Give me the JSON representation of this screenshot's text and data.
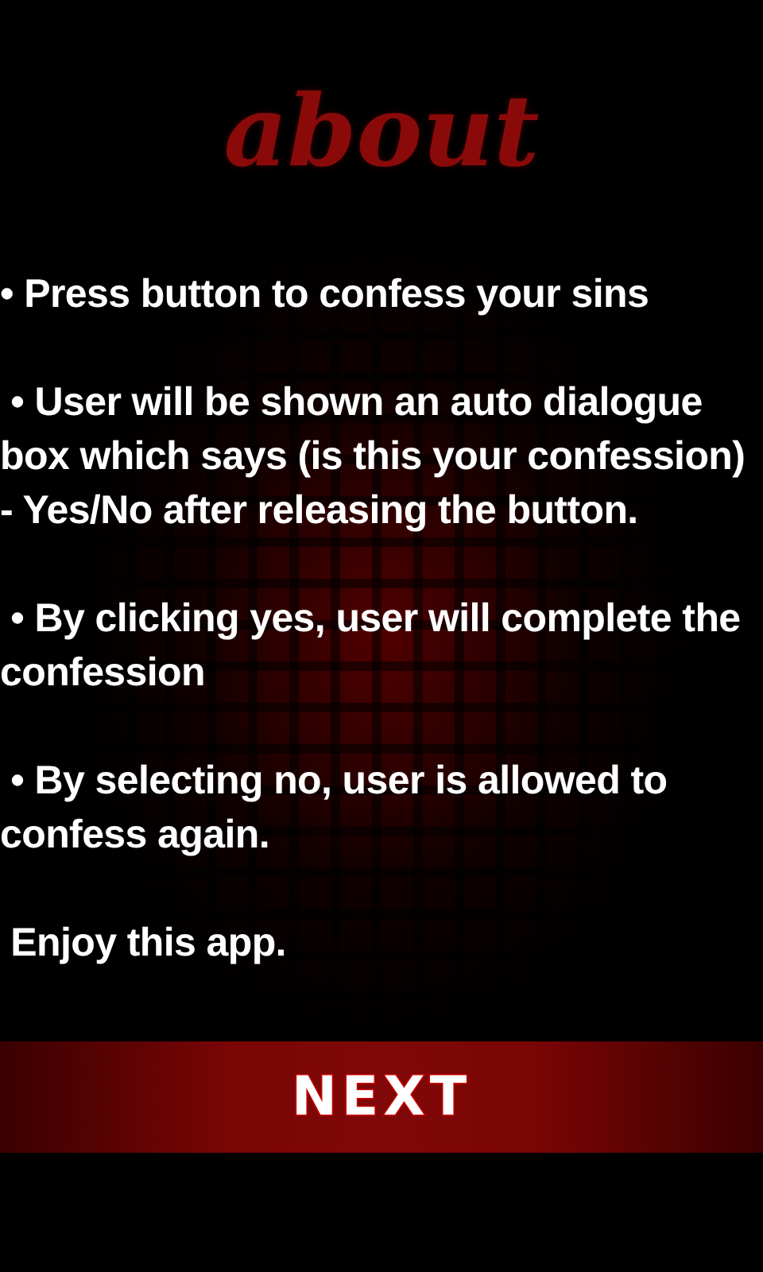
{
  "title": "about",
  "paragraphs": [
    "• Press button to confess your sins",
    " • User will be shown an auto dialogue box which says (is this your confession) - Yes/No after releasing the button.",
    " • By clicking yes, user will complete the confession",
    " • By selecting no, user is allowed to confess again.",
    " Enjoy this app."
  ],
  "button": {
    "label": "NEXT"
  }
}
